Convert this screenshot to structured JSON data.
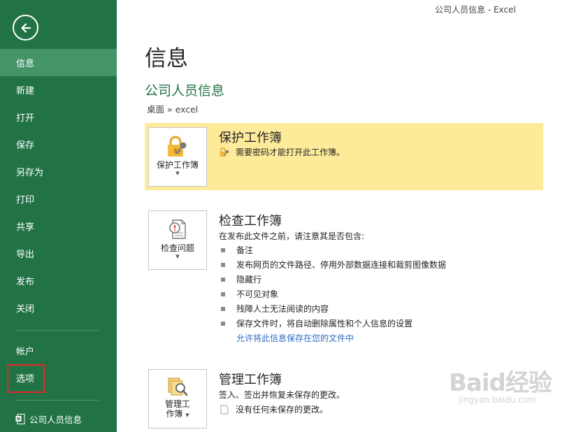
{
  "window": {
    "title": "公司人员信息 - Excel"
  },
  "sidebar": {
    "items": [
      {
        "label": "信息",
        "active": true
      },
      {
        "label": "新建"
      },
      {
        "label": "打开"
      },
      {
        "label": "保存"
      },
      {
        "label": "另存为"
      },
      {
        "label": "打印"
      },
      {
        "label": "共享"
      },
      {
        "label": "导出"
      },
      {
        "label": "发布"
      },
      {
        "label": "关闭"
      }
    ],
    "account_label": "帐户",
    "options_label": "选项",
    "recent_file": "公司人员信息",
    "colors": {
      "background": "#217346",
      "active": "#439467",
      "highlight_box": "#e8242a"
    }
  },
  "main": {
    "page_title": "信息",
    "doc_title": "公司人员信息",
    "doc_path": "桌面 » excel",
    "protect": {
      "tile_label": "保护工作簿",
      "heading": "保护工作簿",
      "description": "需要密码才能打开此工作簿。",
      "background": "#fdeb9a"
    },
    "inspect": {
      "tile_label": "检查问题",
      "heading": "检查工作簿",
      "intro": "在发布此文件之前，请注意其是否包含:",
      "bullets": [
        "备注",
        "发布网页的文件路径、停用外部数据连接和裁剪图像数据",
        "隐藏行",
        "不可见对象",
        "残障人士无法阅读的内容",
        "保存文件时，将自动删除属性和个人信息的设置"
      ],
      "link": "允许将此信息保存在您的文件中"
    },
    "manage": {
      "tile_label_line1": "管理工",
      "tile_label_line2": "作簿",
      "heading": "管理工作簿",
      "intro": "签入、签出并恢复未保存的更改。",
      "status": "没有任何未保存的更改。"
    }
  },
  "watermark": {
    "main": "Baid经验",
    "sub": "jingyan.baidu.com"
  },
  "icons": [
    "back-arrow-icon",
    "lock-key-icon",
    "inspect-document-icon",
    "manage-workbook-icon",
    "excel-file-icon"
  ]
}
